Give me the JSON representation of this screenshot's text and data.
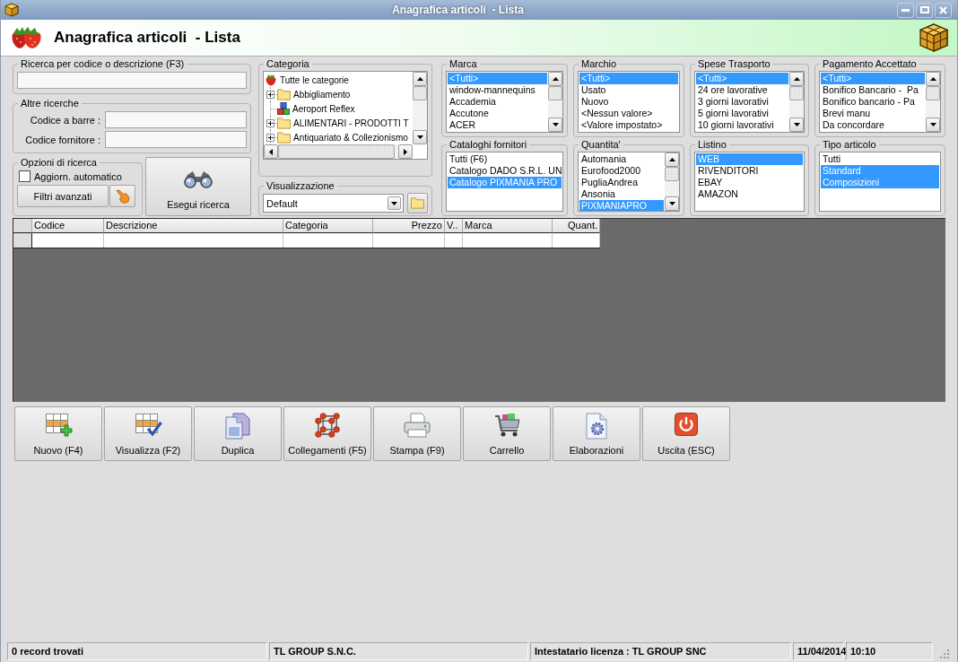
{
  "window": {
    "title": "Anagrafica articoli  - Lista"
  },
  "header": {
    "title": "Anagrafica articoli  - Lista"
  },
  "search": {
    "label": "Ricerca per codice o descrizione (F3)"
  },
  "other_searches": {
    "label": "Altre ricerche",
    "fields": [
      {
        "label": "Codice a barre :"
      },
      {
        "label": "Codice fornitore :"
      }
    ]
  },
  "search_options": {
    "label": "Opzioni di ricerca",
    "auto_update": {
      "label": "Aggiorn. automatico",
      "checked": false
    },
    "advanced_filters": {
      "label": "Filtri avanzati"
    }
  },
  "run_search": {
    "label": "Esegui ricerca"
  },
  "category": {
    "label": "Categoria",
    "tree": [
      {
        "label": "Tutte le categorie",
        "kind": "root",
        "children": [
          {
            "label": "Abbigliamento",
            "kind": "folder",
            "expanded": false
          },
          {
            "label": "Aeroport Reflex",
            "kind": "product"
          },
          {
            "label": "ALIMENTARI - PRODOTTI T",
            "kind": "folder",
            "expanded": false
          },
          {
            "label": "Antiquariato & Collezionismo",
            "kind": "folder",
            "expanded": false
          }
        ]
      }
    ]
  },
  "view": {
    "label": "Visualizzazione",
    "value": "Default"
  },
  "filters": [
    {
      "label": "Marca",
      "scrollbar": true,
      "items": [
        {
          "text": "<Tutti>",
          "selected": true
        },
        {
          "text": "window-mannequins",
          "selected": false
        },
        {
          "text": "Accademia",
          "selected": false
        },
        {
          "text": "Accutone",
          "selected": false
        },
        {
          "text": "ACER",
          "selected": false
        }
      ]
    },
    {
      "label": "Marchio",
      "scrollbar": false,
      "items": [
        {
          "text": "<Tutti>",
          "selected": true
        },
        {
          "text": "Usato",
          "selected": false
        },
        {
          "text": "Nuovo",
          "selected": false
        },
        {
          "text": "<Nessun valore>",
          "selected": false
        },
        {
          "text": "<Valore impostato>",
          "selected": false
        }
      ]
    },
    {
      "label": "Spese Trasporto",
      "scrollbar": true,
      "items": [
        {
          "text": "<Tutti>",
          "selected": true
        },
        {
          "text": "24 ore lavorative",
          "selected": false
        },
        {
          "text": "3 giorni lavorativi",
          "selected": false
        },
        {
          "text": "5 giorni lavorativi",
          "selected": false
        },
        {
          "text": "10 giorni lavorativi",
          "selected": false
        }
      ]
    },
    {
      "label": "Pagamento Accettato",
      "scrollbar": true,
      "items": [
        {
          "text": "<Tutti>",
          "selected": true
        },
        {
          "text": "Bonifico Bancario -  Pa",
          "selected": false
        },
        {
          "text": "Bonifico bancario - Pa",
          "selected": false
        },
        {
          "text": "Brevi manu",
          "selected": false
        },
        {
          "text": "Da concordare",
          "selected": false
        }
      ]
    },
    {
      "label": "Cataloghi fornitori",
      "scrollbar": false,
      "items": [
        {
          "text": "Tutti (F6)",
          "selected": false
        },
        {
          "text": "Catalogo DADO S.R.L. UN",
          "selected": false
        },
        {
          "text": "Catalogo PIXMANIA PRO",
          "selected": true
        }
      ]
    },
    {
      "label": "Quantita'",
      "scrollbar": true,
      "items": [
        {
          "text": "Automania",
          "selected": false
        },
        {
          "text": "Eurofood2000",
          "selected": false
        },
        {
          "text": "PugliaAndrea",
          "selected": false
        },
        {
          "text": "Ansonia",
          "selected": false
        },
        {
          "text": "PIXMANIAPRO",
          "selected": true
        }
      ]
    },
    {
      "label": "Listino",
      "scrollbar": false,
      "items": [
        {
          "text": "WEB",
          "selected": true
        },
        {
          "text": "RIVENDITORI",
          "selected": false
        },
        {
          "text": "EBAY",
          "selected": false
        },
        {
          "text": "AMAZON",
          "selected": false
        }
      ]
    },
    {
      "label": "Tipo articolo",
      "scrollbar": false,
      "items": [
        {
          "text": "Tutti",
          "selected": false
        },
        {
          "text": "Standard",
          "selected": true
        },
        {
          "text": "Composizioni",
          "selected": true
        }
      ]
    }
  ],
  "table": {
    "columns": [
      {
        "label": "Codice",
        "kind": "text"
      },
      {
        "label": "Descrizione",
        "kind": "text"
      },
      {
        "label": "Categoria",
        "kind": "text"
      },
      {
        "label": "Prezzo",
        "kind": "number"
      },
      {
        "label": "V..",
        "kind": "text"
      },
      {
        "label": "Marca",
        "kind": "text"
      },
      {
        "label": "Quant.",
        "kind": "number"
      }
    ]
  },
  "actions": [
    {
      "label": "Nuovo (F4)"
    },
    {
      "label": "Visualizza (F2)"
    },
    {
      "label": "Duplica"
    },
    {
      "label": "Collegamenti (F5)"
    },
    {
      "label": "Stampa (F9)"
    },
    {
      "label": "Carrello"
    },
    {
      "label": "Elaborazioni"
    },
    {
      "label": "Uscita (ESC)"
    }
  ],
  "status_bar": [
    {
      "text": "0 record trovati"
    },
    {
      "text": "TL GROUP S.N.C."
    },
    {
      "text": "Intestatario licenza : TL GROUP SNC"
    },
    {
      "text": "11/04/2014"
    },
    {
      "text": "10:10"
    }
  ]
}
